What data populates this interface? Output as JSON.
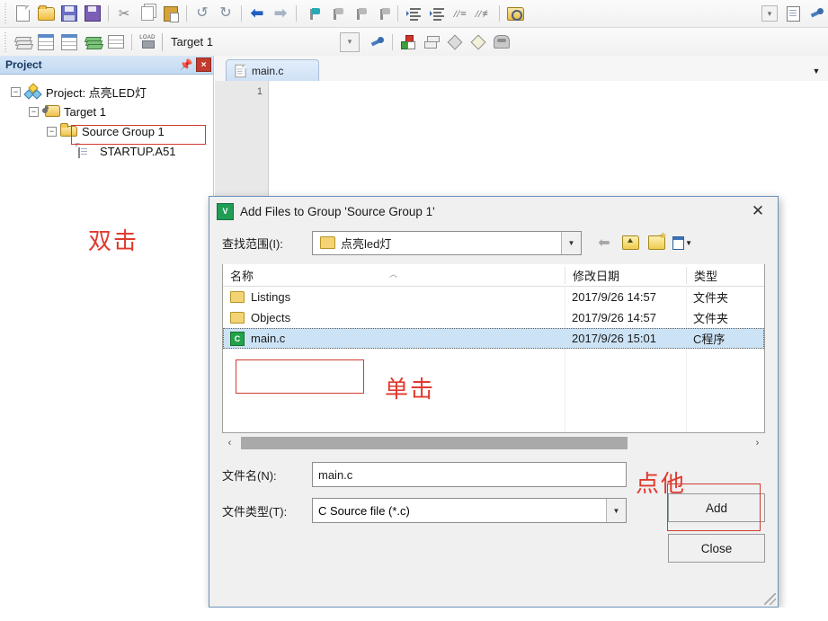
{
  "toolbar": {
    "row1": [
      {
        "name": "new-file-icon",
        "glyph": "page"
      },
      {
        "name": "open-file-icon",
        "glyph": "folder-open"
      },
      {
        "name": "save-icon",
        "glyph": "save"
      },
      {
        "name": "save-all-icon",
        "glyph": "save-all"
      },
      {
        "name": "cut-icon",
        "glyph": "cut"
      },
      {
        "name": "copy-icon",
        "glyph": "copy"
      },
      {
        "name": "paste-icon",
        "glyph": "paste"
      },
      {
        "name": "undo-icon",
        "glyph": "undo"
      },
      {
        "name": "redo-icon",
        "glyph": "redo"
      },
      {
        "name": "navigate-back-icon",
        "glyph": "arrow-left"
      },
      {
        "name": "navigate-forward-icon",
        "glyph": "arrow-right"
      },
      {
        "name": "toggle-bookmark-icon",
        "glyph": "bookmark"
      },
      {
        "name": "next-bookmark-icon",
        "glyph": "bookmark-next"
      },
      {
        "name": "prev-bookmark-icon",
        "glyph": "bookmark-prev"
      },
      {
        "name": "clear-bookmarks-icon",
        "glyph": "bookmark-clear"
      },
      {
        "name": "indent-icon",
        "glyph": "indent"
      },
      {
        "name": "outdent-icon",
        "glyph": "outdent"
      },
      {
        "name": "comment-icon",
        "glyph": "comment"
      },
      {
        "name": "uncomment-icon",
        "glyph": "uncomment"
      },
      {
        "name": "bookmark-folder-icon",
        "glyph": "bm-folder"
      },
      {
        "name": "toolbar-overflow-chevron-icon",
        "glyph": "chevron"
      },
      {
        "name": "configure-icon",
        "glyph": "doc-config"
      },
      {
        "name": "options-icon",
        "glyph": "wrench"
      }
    ],
    "row2_left": [
      {
        "name": "translate-icon",
        "glyph": "books"
      },
      {
        "name": "build-icon",
        "glyph": "build"
      },
      {
        "name": "rebuild-icon",
        "glyph": "rebuild"
      },
      {
        "name": "batch-build-icon",
        "glyph": "books-green"
      },
      {
        "name": "stop-build-icon",
        "glyph": "build-stop"
      },
      {
        "name": "download-icon",
        "glyph": "load"
      }
    ],
    "row2_right": [
      {
        "name": "target-options-icon",
        "glyph": "wrench"
      },
      {
        "name": "manage-components-icon",
        "glyph": "blocks"
      },
      {
        "name": "manage-layers-icon",
        "glyph": "stack"
      },
      {
        "name": "pack-installer-icon",
        "glyph": "diamond"
      },
      {
        "name": "pack-yellow-icon",
        "glyph": "diamond-y"
      },
      {
        "name": "manage-run-env-icon",
        "glyph": "mask"
      }
    ],
    "target_label": "Target 1"
  },
  "project_panel": {
    "title": "Project",
    "pin_tooltip": "Auto Hide",
    "close_label": "×",
    "tree": [
      {
        "label": "Project: 点亮LED灯",
        "icon": "project-icon",
        "expander": "−",
        "indent": 0
      },
      {
        "label": "Target 1",
        "icon": "target-icon",
        "expander": "−",
        "indent": 1
      },
      {
        "label": "Source Group 1",
        "icon": "group-icon",
        "expander": "−",
        "indent": 2,
        "highlighted": true
      },
      {
        "label": "STARTUP.A51",
        "icon": "file-icon",
        "expander": "",
        "indent": 3
      }
    ]
  },
  "annotations": {
    "double_click": "双击",
    "single_click": "单击",
    "click_this": "点他",
    "color": "#e03a2f"
  },
  "editor": {
    "tab_label": "main.c",
    "line_numbers": [
      "1"
    ],
    "dropdown_icon": "chevron-down-icon"
  },
  "dialog": {
    "title": "Add Files to Group 'Source Group 1'",
    "app_icon": "keil-uvision-icon",
    "close_label": "✕",
    "look_in_label": "查找范围(I):",
    "look_in_value": "点亮led灯",
    "nav": {
      "back": "back-arrow-icon",
      "up": "up-folder-icon",
      "new_folder": "new-folder-icon",
      "views": "views-icon"
    },
    "columns": [
      "名称",
      "修改日期",
      "类型"
    ],
    "files": [
      {
        "name": "Listings",
        "modified": "2017/9/26 14:57",
        "type": "文件夹",
        "icon": "folder-icon",
        "selected": false
      },
      {
        "name": "Objects",
        "modified": "2017/9/26 14:57",
        "type": "文件夹",
        "icon": "folder-icon",
        "selected": false
      },
      {
        "name": "main.c",
        "modified": "2017/9/26 15:01",
        "type": "C程序",
        "icon": "c-file-icon",
        "selected": true
      }
    ],
    "filename_label": "文件名(N):",
    "filename_value": "main.c",
    "filetype_label": "文件类型(T):",
    "filetype_value": "C Source file (*.c)",
    "filetype_options": [
      "C Source file (*.c)"
    ],
    "add_button": "Add",
    "close_button": "Close"
  }
}
